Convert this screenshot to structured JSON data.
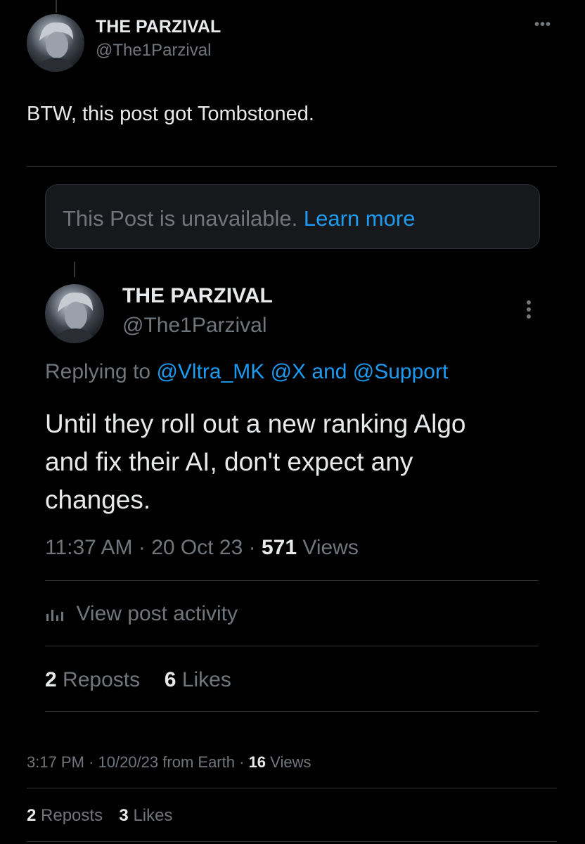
{
  "outer_post": {
    "author": {
      "name": "THE PARZIVAL",
      "handle": "@The1Parzival"
    },
    "text": "BTW, this post got Tombstoned.",
    "unavailable": {
      "message": "This Post is unavailable.",
      "link": "Learn more"
    },
    "more_icon": "ellipsis-horizontal",
    "meta": {
      "time": "3:17 PM",
      "date": "10/20/23",
      "source": "from Earth",
      "views_count": "16",
      "views_label": "Views"
    },
    "stats": {
      "reposts_count": "2",
      "reposts_label": "Reposts",
      "likes_count": "3",
      "likes_label": "Likes"
    }
  },
  "quoted_post": {
    "author": {
      "name": "THE PARZIVAL",
      "handle": "@The1Parzival"
    },
    "more_icon": "ellipsis-vertical",
    "replying": {
      "prefix": "Replying to",
      "mentions": "@Vltra_MK @X and @Support"
    },
    "text_line1": "Until they roll out a new ranking Algo",
    "text_line2": "and fix their AI, don't expect any",
    "text_line3": "changes.",
    "meta": {
      "time": "11:37 AM",
      "date": "20 Oct 23",
      "views_count": "571",
      "views_label": "Views"
    },
    "activity": {
      "icon": "bar-chart-icon",
      "label": "View post activity"
    },
    "stats": {
      "reposts_count": "2",
      "reposts_label": "Reposts",
      "likes_count": "6",
      "likes_label": "Likes"
    }
  }
}
